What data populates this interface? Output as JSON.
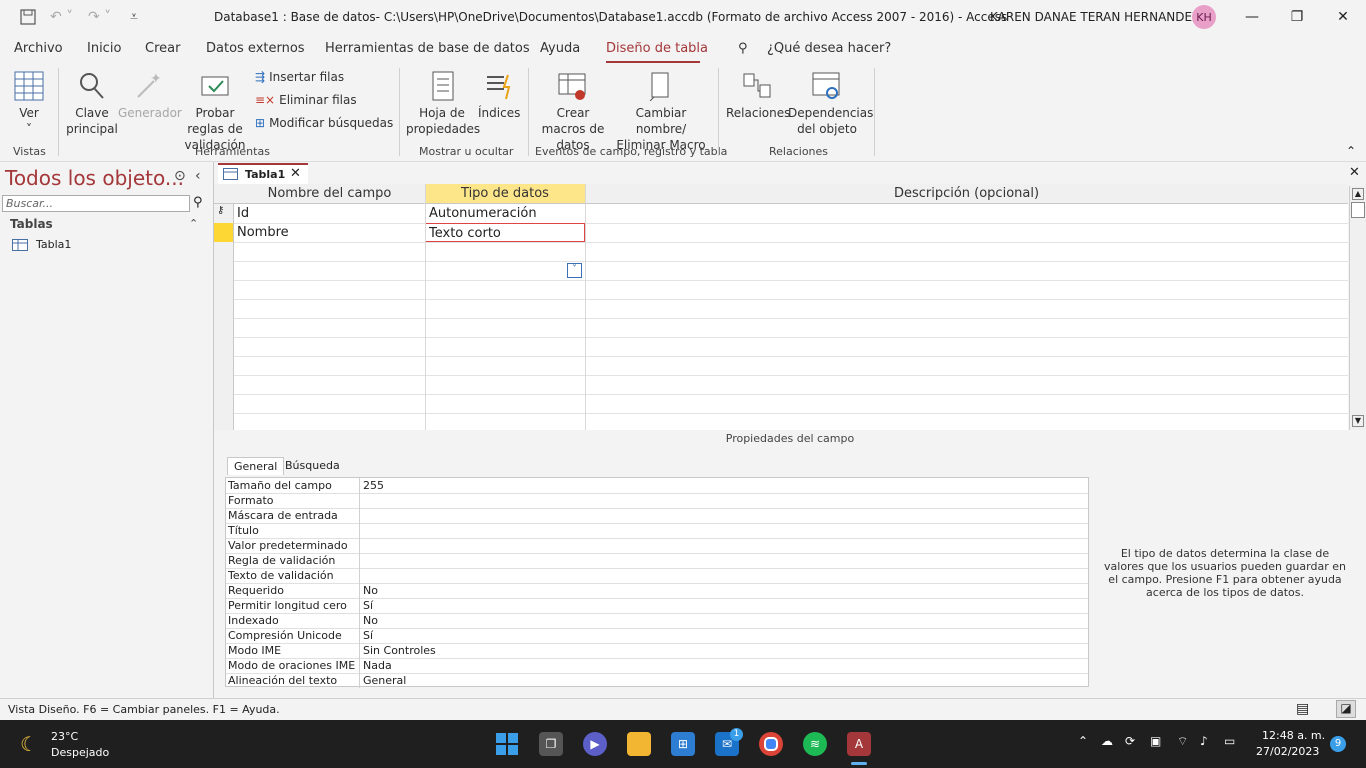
{
  "titlebar": {
    "title": "Database1 : Base de datos- C:\\Users\\HP\\OneDrive\\Documentos\\Database1.accdb (Formato de archivo Access 2007 - 2016)  -  Access",
    "user": "KAREN DANAE TERAN HERNANDEZ",
    "initials": "KH"
  },
  "menu": {
    "items": [
      "Archivo",
      "Inicio",
      "Crear",
      "Datos externos",
      "Herramientas de base de datos",
      "Ayuda"
    ],
    "active": "Diseño de tabla",
    "search": "¿Qué desea hacer?"
  },
  "ribbon": {
    "ver": "Ver",
    "clave": "Clave principal",
    "generador": "Generador",
    "probar": "Probar reglas de validación",
    "insertar": "Insertar filas",
    "eliminar": "Eliminar filas",
    "modificar": "Modificar búsquedas",
    "hoja": "Hoja de propiedades",
    "indices": "Índices",
    "crear_macros": "Crear macros de datos",
    "cambiar": "Cambiar nombre/ Eliminar Macro",
    "relaciones": "Relaciones",
    "dependencias": "Dependencias del objeto",
    "groups": {
      "vistas": "Vistas",
      "herramientas": "Herramientas",
      "mostrar": "Mostrar u ocultar",
      "eventos": "Eventos de campo, registro y tabla",
      "relaciones": "Relaciones"
    }
  },
  "nav": {
    "title": "Todos los objeto...",
    "search_placeholder": "Buscar...",
    "section": "Tablas",
    "items": [
      "Tabla1"
    ]
  },
  "doc_tab": "Tabla1",
  "grid": {
    "headers": [
      "Nombre del campo",
      "Tipo de datos",
      "Descripción (opcional)"
    ],
    "rows": [
      {
        "name": "Id",
        "type": "Autonumeración"
      },
      {
        "name": "Nombre",
        "type": "Texto corto"
      }
    ]
  },
  "props": {
    "label": "Propiedades del campo",
    "tabs": [
      "General",
      "Búsqueda"
    ],
    "rows": [
      {
        "label": "Tamaño del campo",
        "value": "255"
      },
      {
        "label": "Formato",
        "value": ""
      },
      {
        "label": "Máscara de entrada",
        "value": ""
      },
      {
        "label": "Título",
        "value": ""
      },
      {
        "label": "Valor predeterminado",
        "value": ""
      },
      {
        "label": "Regla de validación",
        "value": ""
      },
      {
        "label": "Texto de validación",
        "value": ""
      },
      {
        "label": "Requerido",
        "value": "No"
      },
      {
        "label": "Permitir longitud cero",
        "value": "Sí"
      },
      {
        "label": "Indexado",
        "value": "No"
      },
      {
        "label": "Compresión Unicode",
        "value": "Sí"
      },
      {
        "label": "Modo IME",
        "value": "Sin Controles"
      },
      {
        "label": "Modo de oraciones IME",
        "value": "Nada"
      },
      {
        "label": "Alineación del texto",
        "value": "General"
      }
    ],
    "help": "El tipo de datos determina la clase de valores que los usuarios pueden guardar en el campo. Presione F1 para obtener ayuda acerca de los tipos de datos."
  },
  "status": "Vista Diseño.  F6 = Cambiar paneles.  F1 = Ayuda.",
  "taskbar": {
    "temp": "23°C",
    "weather": "Despejado",
    "time": "12:48 a. m.",
    "date": "27/02/2023",
    "mail_badge": "1",
    "notif": "9"
  }
}
